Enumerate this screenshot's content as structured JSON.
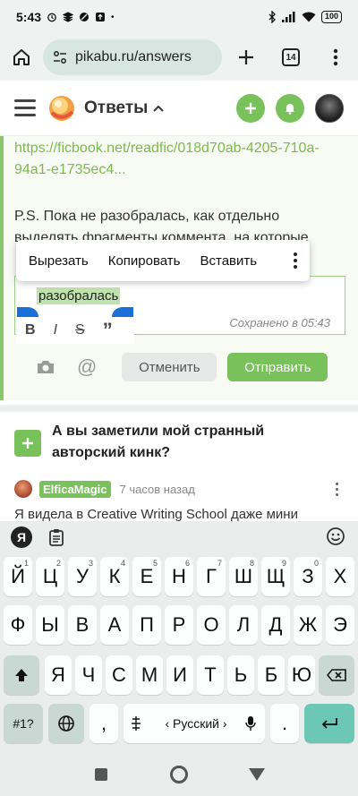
{
  "statusbar": {
    "time": "5:43",
    "battery": "100"
  },
  "browser": {
    "url": "pikabu.ru/answers",
    "tab_count": "14"
  },
  "site": {
    "title": "Ответы"
  },
  "comment": {
    "link": "https://ficbook.net/readfic/018d70ab-4205-710a-94a1-e1735ec4...",
    "ps_text": "P.S. Пока не разобралась, как отдельно выделять фрагменты коммента, на которые"
  },
  "context_menu": {
    "cut": "Вырезать",
    "copy": "Копировать",
    "paste": "Вставить"
  },
  "editor": {
    "selected_text": "разобралась",
    "saved_status": "Сохранено в 05:43",
    "format": {
      "bold": "B",
      "italic": "I",
      "strike": "S",
      "quote": "”"
    },
    "cancel_label": "Отменить",
    "send_label": "Отправить"
  },
  "question": {
    "title": "А вы заметили мой странный авторский кинк?",
    "author": "ElficaMagic",
    "time": "7 часов назад",
    "preview": "Я видела в Creative Writing School даже мини"
  },
  "keyboard": {
    "logo": "Я",
    "row1": [
      {
        "k": "Й",
        "h": "1"
      },
      {
        "k": "Ц",
        "h": "2"
      },
      {
        "k": "У",
        "h": "3"
      },
      {
        "k": "К",
        "h": "4"
      },
      {
        "k": "Е",
        "h": "5"
      },
      {
        "k": "Н",
        "h": "6"
      },
      {
        "k": "Г",
        "h": "7"
      },
      {
        "k": "Ш",
        "h": "8"
      },
      {
        "k": "Щ",
        "h": "9"
      },
      {
        "k": "З",
        "h": "0"
      },
      {
        "k": "Х",
        "h": ""
      }
    ],
    "row2": [
      "Ф",
      "Ы",
      "В",
      "А",
      "П",
      "Р",
      "О",
      "Л",
      "Д",
      "Ж",
      "Э"
    ],
    "row3": [
      "Я",
      "Ч",
      "С",
      "М",
      "И",
      "Т",
      "Ь",
      "Б",
      "Ю"
    ],
    "symbols_label": "#1?",
    "comma": ",",
    "period": ".",
    "language": "‹ Русский ›"
  }
}
